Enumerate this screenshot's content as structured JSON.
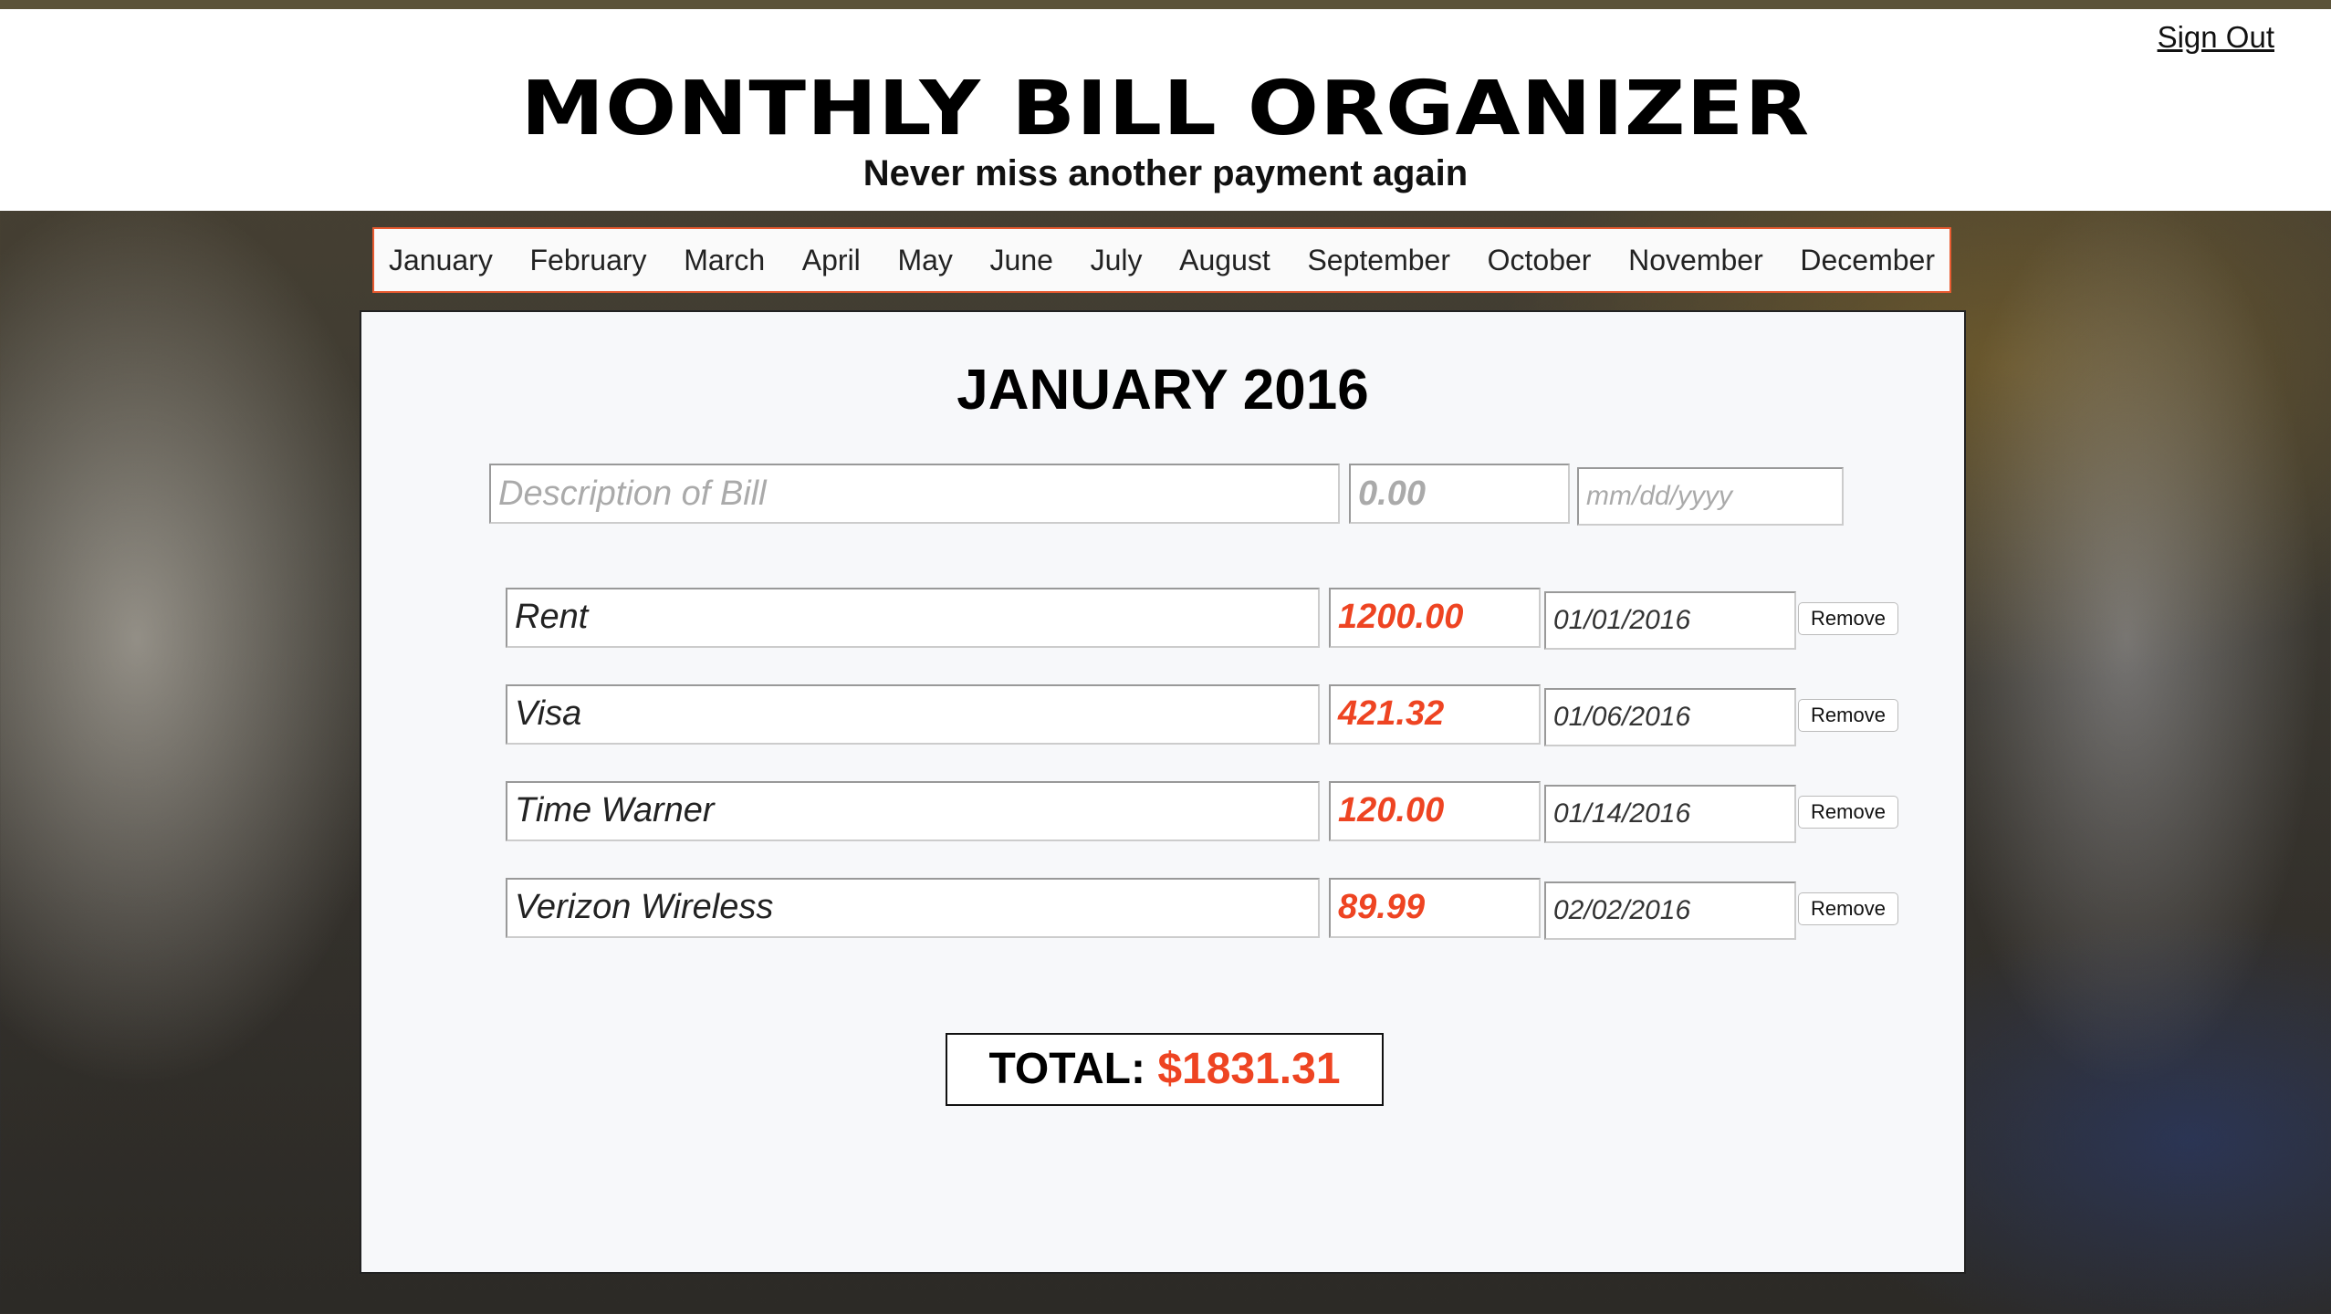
{
  "header": {
    "title": "MONTHLY BILL ORGANIZER",
    "subtitle": "Never miss another payment again",
    "sign_out": "Sign Out"
  },
  "months": [
    "January",
    "February",
    "March",
    "April",
    "May",
    "June",
    "July",
    "August",
    "September",
    "October",
    "November",
    "December"
  ],
  "panel": {
    "title": "JANUARY 2016"
  },
  "new_bill": {
    "description_placeholder": "Description of Bill",
    "amount_placeholder": "0.00",
    "date_placeholder": "mm/dd/yyyy"
  },
  "bills": [
    {
      "description": "Rent",
      "amount": "1200.00",
      "date": "01/01/2016",
      "remove_label": "Remove"
    },
    {
      "description": "Visa",
      "amount": "421.32",
      "date": "01/06/2016",
      "remove_label": "Remove"
    },
    {
      "description": "Time Warner",
      "amount": "120.00",
      "date": "01/14/2016",
      "remove_label": "Remove"
    },
    {
      "description": "Verizon Wireless",
      "amount": "89.99",
      "date": "02/02/2016",
      "remove_label": "Remove"
    }
  ],
  "total": {
    "label": "TOTAL:",
    "value": "$1831.31"
  },
  "colors": {
    "accent": "#ee4422",
    "nav_border": "#e85a30"
  }
}
